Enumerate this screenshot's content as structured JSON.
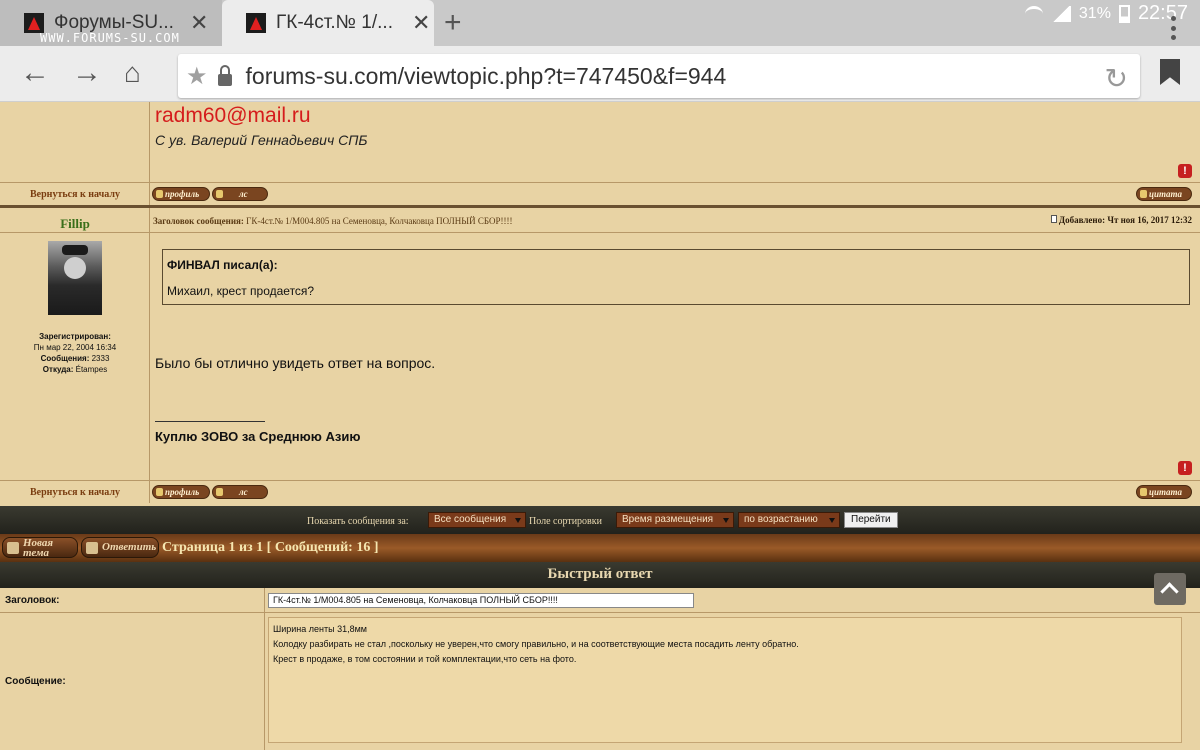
{
  "browser": {
    "brand_overlay": "WWW.FORUMS-SU.COM",
    "tabs": [
      {
        "title": "Форумы-SU...",
        "active": false
      },
      {
        "title": "ГК-4ст.№ 1/...",
        "active": true
      }
    ],
    "url": "forums-su.com/viewtopic.php?t=747450&f=944",
    "status": {
      "battery": "31%",
      "time": "22:57"
    }
  },
  "post_prev": {
    "email": "radm60@mail.ru",
    "signature": "С ув. Валерий Геннадьевич СПБ",
    "back_link": "Вернуться к началу",
    "profile_label": "профиль",
    "pm_label": "лс",
    "quote_label": "цитата"
  },
  "post": {
    "author": "Fillip",
    "subject_label": "Заголовок сообщения:",
    "subject": "ГК-4ст.№ 1/М004.805 на Семеновца, Колчаковца ПОЛНЫЙ СБОР!!!!",
    "posted_label": "Добавлено:",
    "posted": "Чт ноя 16, 2017 12:32",
    "user": {
      "registered_label": "Зарегистрирован:",
      "registered": "Пн мар 22, 2004 16:34",
      "messages_label": "Сообщения:",
      "messages": "2333",
      "from_label": "Откуда:",
      "from": "Étampes"
    },
    "quote_author": "ФИНВАЛ писал(а):",
    "quote_text": "Михаил, крест продается?",
    "text": "Было бы отлично увидеть ответ на вопрос.",
    "signature": "Куплю ЗОВО за Среднюю Азию",
    "back_link": "Вернуться к началу",
    "profile_label": "профиль",
    "pm_label": "лс",
    "quote_label": "цитата"
  },
  "sort_bar": {
    "show_label": "Показать сообщения за:",
    "show_value": "Все сообщения",
    "sort_label": "Поле сортировки",
    "sort_value": "Время размещения",
    "order_value": "по возрастанию",
    "go_label": "Перейти"
  },
  "pagination": {
    "new_topic": "Новая тема",
    "reply": "Ответить",
    "text": "Страница 1 из 1  [ Сообщений: 16 ]"
  },
  "quick_reply": {
    "title": "Быстрый ответ",
    "subject_label": "Заголовок:",
    "subject_value": "ГК-4ст.№ 1/М004.805 на Семеновца, Колчаковца ПОЛНЫЙ СБОР!!!!",
    "message_label": "Сообщение:",
    "message_lines": [
      "Ширина  ленты 31,8мм",
      "Колодку  разбирать  не стал ,поскольку  не уверен,что смогу правильно, и на соответствующие места  посадить  ленту  обратно.",
      "Крест  в продаже, в том состоянии  и той  комплектации,что сеть  на фото."
    ]
  }
}
